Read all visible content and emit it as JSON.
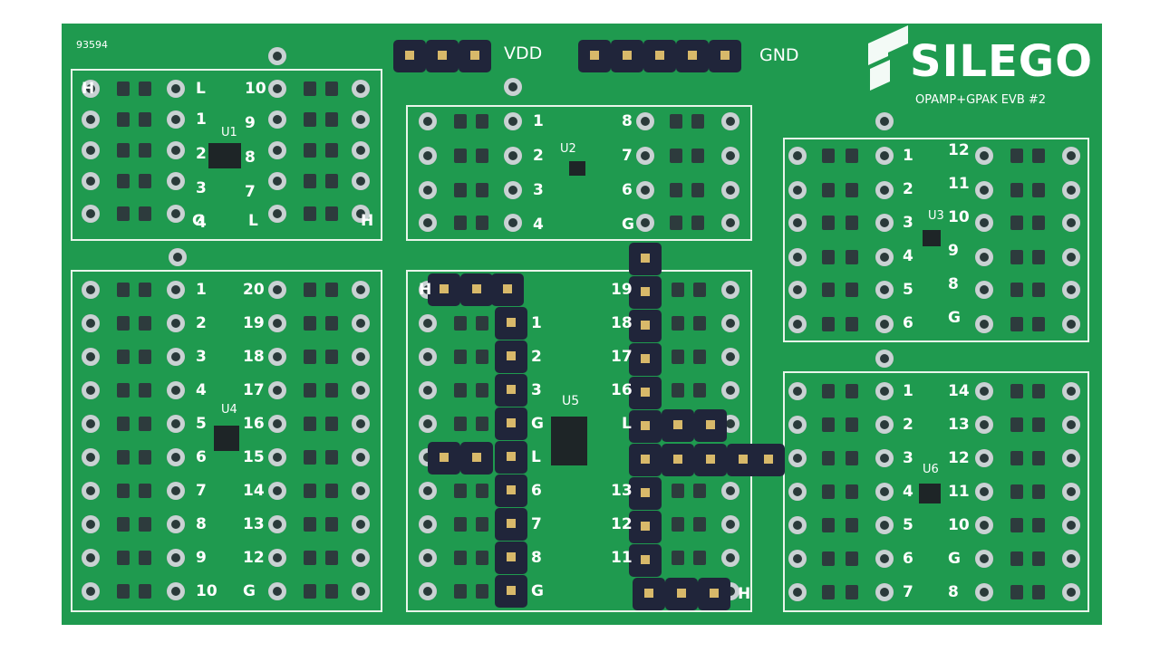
{
  "board": {
    "serial": "93594",
    "vdd_label": "VDD",
    "gnd_label": "GND",
    "logo_text": "SILEGO",
    "subtitle": "OPAMP+GPAK EVB #2",
    "colors": {
      "board": "#1f9a4f",
      "silk": "#ffffff",
      "pad": "#2d3b3d",
      "header": "#20253a"
    }
  },
  "u1": {
    "name": "U1",
    "left": [
      "H",
      "1",
      "2",
      "3",
      "4",
      "G"
    ],
    "left_row0": [
      "H",
      "L"
    ],
    "right": [
      "10",
      "9",
      "8",
      "7"
    ],
    "bottom": [
      "G",
      "L",
      "H"
    ]
  },
  "u2": {
    "name": "U2",
    "left": [
      "1",
      "2",
      "3",
      "4"
    ],
    "right": [
      "8",
      "7",
      "6",
      "G"
    ]
  },
  "u3": {
    "name": "U3",
    "left": [
      "1",
      "2",
      "3",
      "4",
      "5",
      "6"
    ],
    "right": [
      "12",
      "11",
      "10",
      "9",
      "8",
      "G"
    ]
  },
  "u4": {
    "name": "U4",
    "left": [
      "1",
      "2",
      "3",
      "4",
      "5",
      "6",
      "7",
      "8",
      "9",
      "10"
    ],
    "right": [
      "20",
      "19",
      "18",
      "17",
      "16",
      "15",
      "14",
      "13",
      "12",
      "G"
    ]
  },
  "u5": {
    "name": "U5",
    "left": [
      "H",
      "1",
      "2",
      "3",
      "G",
      "L",
      "6",
      "7",
      "8",
      "G"
    ],
    "right": [
      "19",
      "18",
      "17",
      "16",
      "L",
      "13",
      "12",
      "11",
      "H"
    ]
  },
  "u6": {
    "name": "U6",
    "left": [
      "1",
      "2",
      "3",
      "4",
      "5",
      "6",
      "7"
    ],
    "right": [
      "14",
      "13",
      "12",
      "11",
      "10",
      "G",
      "8"
    ]
  }
}
